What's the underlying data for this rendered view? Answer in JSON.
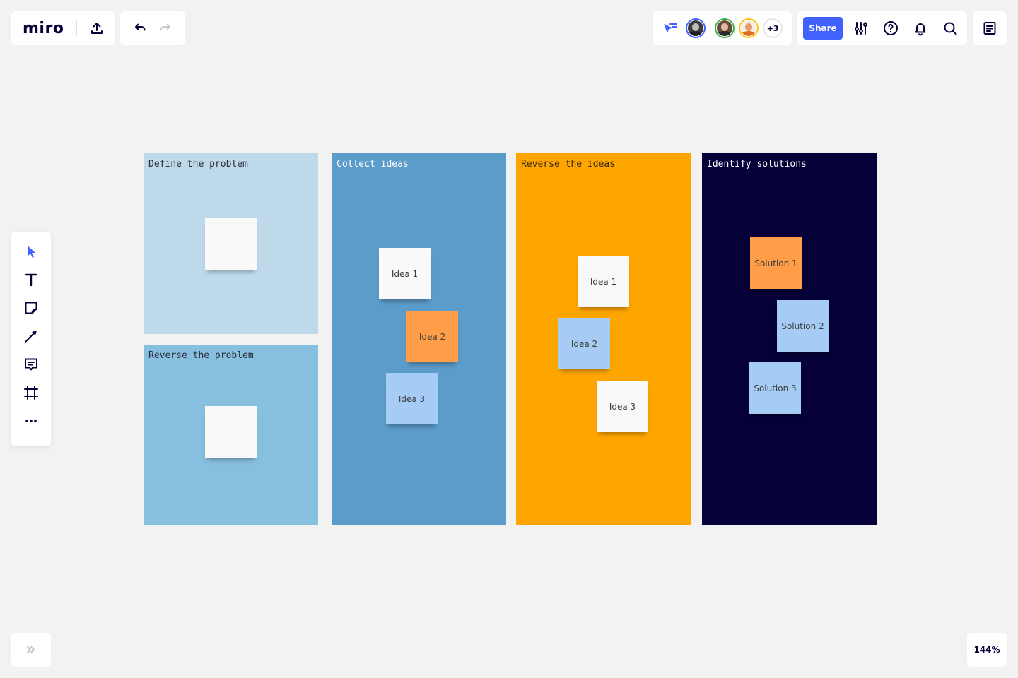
{
  "app": {
    "logo": "miro",
    "share_label": "Share",
    "zoom_level": "144%",
    "more_collaborators": "+3"
  },
  "colors": {
    "accent": "#4262ff",
    "ink": "#050038",
    "canvas": "#f2f2f2"
  },
  "topbar": {
    "left": [
      {
        "name": "export-icon"
      },
      {
        "name": "undo-icon"
      },
      {
        "name": "redo-icon",
        "disabled": true
      }
    ],
    "collaborators": [
      {
        "name": "avatar-1",
        "ring": "#4262ff"
      },
      {
        "name": "avatar-2",
        "ring": "#3fb34f"
      },
      {
        "name": "avatar-3",
        "ring": "#fac710"
      }
    ],
    "tools": [
      "settings-sliders-icon",
      "help-icon",
      "notifications-bell-icon",
      "search-icon"
    ]
  },
  "left_toolbar": [
    "select-cursor-icon",
    "text-icon",
    "sticky-note-icon",
    "arrow-line-icon",
    "comment-icon",
    "frame-icon",
    "more-icon"
  ],
  "frames": [
    {
      "title": "Define the problem",
      "bg": "#bdd9ea",
      "text_color": "#2b2b3a",
      "stickies": [
        {
          "text": "",
          "color": "#f9f9f9"
        }
      ]
    },
    {
      "title": "Reverse the problem",
      "bg": "#87bfde",
      "text_color": "#2b2b3a",
      "stickies": [
        {
          "text": "",
          "color": "#f9f9f9"
        }
      ]
    },
    {
      "title": "Collect ideas",
      "bg": "#5c9ccb",
      "text_color": "#ffffff",
      "stickies": [
        {
          "text": "Idea 1",
          "color": "#f9f9f9"
        },
        {
          "text": "Idea 2",
          "color": "#ff9d48"
        },
        {
          "text": "Idea 3",
          "color": "#a6ccf5"
        }
      ]
    },
    {
      "title": "Reverse the ideas",
      "bg": "#ffa500",
      "text_color": "#3a2a10",
      "stickies": [
        {
          "text": "Idea 1",
          "color": "#f9f9f9"
        },
        {
          "text": "Idea 2",
          "color": "#a6ccf5"
        },
        {
          "text": "Idea 3",
          "color": "#f9f9f9"
        }
      ]
    },
    {
      "title": "Identify solutions",
      "bg": "#050038",
      "text_color": "#ffffff",
      "stickies": [
        {
          "text": "Solution 1",
          "color": "#ff9d48"
        },
        {
          "text": "Solution 2",
          "color": "#a6ccf5"
        },
        {
          "text": "Solution 3",
          "color": "#a6ccf5"
        }
      ]
    }
  ]
}
